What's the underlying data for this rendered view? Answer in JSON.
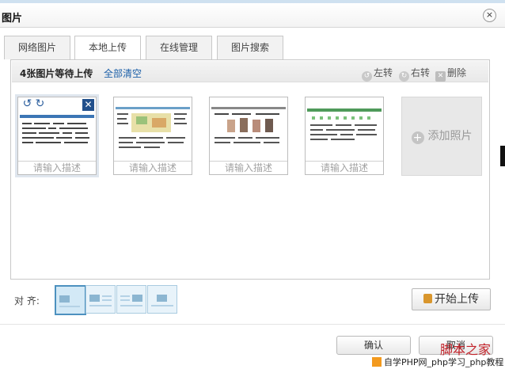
{
  "dialog": {
    "title": "图片",
    "close_symbol": "×"
  },
  "tabs": [
    {
      "label": "网络图片",
      "active": false
    },
    {
      "label": "本地上传",
      "active": true
    },
    {
      "label": "在线管理",
      "active": false
    },
    {
      "label": "图片搜索",
      "active": false
    }
  ],
  "upload_bar": {
    "count_text": "4张图片等待上传",
    "clear_all": "全部清空",
    "rotate_left": "左转",
    "rotate_right": "右转",
    "delete": "删除"
  },
  "images": [
    {
      "placeholder": "请输入描述",
      "selected": true
    },
    {
      "placeholder": "请输入描述",
      "selected": false
    },
    {
      "placeholder": "请输入描述",
      "selected": false
    },
    {
      "placeholder": "请输入描述",
      "selected": false
    }
  ],
  "add_photo": {
    "label": "添加照片"
  },
  "align": {
    "label": "对  齐:",
    "options": [
      "none",
      "left",
      "right",
      "center"
    ],
    "selected": "none"
  },
  "start_upload": {
    "label": "开始上传"
  },
  "footer": {
    "ok": "确认",
    "cancel": "取消"
  },
  "watermark": {
    "brand": "脚本之家",
    "bar": "自学PHP网_php学习_php教程"
  },
  "colors": {
    "accent_link": "#1b5fa8",
    "selected_border": "#4d91bf",
    "watermark_red": "#c2232a"
  }
}
